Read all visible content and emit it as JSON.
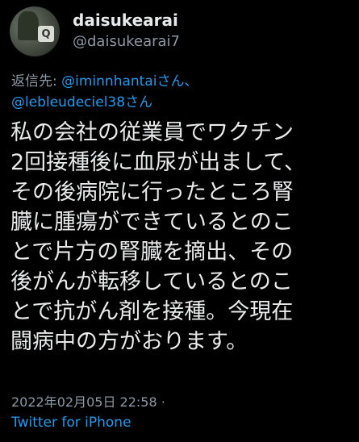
{
  "user": {
    "display_name": "daisukearai",
    "handle": "@daisukearai7"
  },
  "reply": {
    "prefix": "返信先: ",
    "mention_1": "@iminnhantaiさん、",
    "mention_2": "@lebleudeciel38さん"
  },
  "tweet": {
    "lines": [
      "私の会社の従業員でワクチン",
      "2回接種後に血尿が出まして、",
      "その後病院に行ったところ腎",
      "臓に腫瘍ができているとのこ",
      "とで片方の腎臓を摘出、その",
      "後がんが転移しているとのこ",
      "とで抗がん剤を接種。今現在",
      "闘病中の方がおります。"
    ]
  },
  "meta": {
    "timestamp": "2022年02月05日 22:58 ·",
    "source": "Twitter for iPhone"
  },
  "colors": {
    "background": "#000000",
    "text": "#e7e9ea",
    "secondary": "#8b98a5",
    "link": "#1d9bf0"
  }
}
